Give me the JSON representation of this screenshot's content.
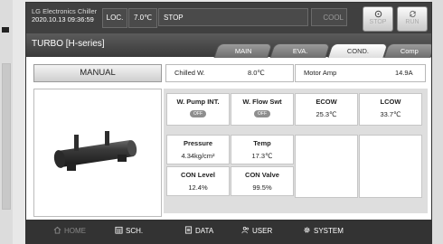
{
  "status": {
    "brand": "LG Electronics Chiller",
    "datetime": "2020.10.13 09:36:59",
    "mode": "LOC.",
    "temperature": "7.0℃",
    "state": "STOP",
    "operation": "COOL",
    "stop_label": "STOP",
    "run_label": "RUN"
  },
  "header": {
    "model": "TURBO [H-series]",
    "tabs": [
      "MAIN",
      "EVA.",
      "COND.",
      "Comp"
    ],
    "active_tab": "COND."
  },
  "main": {
    "manual_label": "MANUAL",
    "chilled_w": {
      "label": "Chilled W.",
      "value": "8.0℃"
    },
    "motor_amp": {
      "label": "Motor Amp",
      "value": "14.9A"
    },
    "cells": [
      {
        "label": "W. Pump INT.",
        "value": "OFF"
      },
      {
        "label": "W. Flow Swt",
        "value": "OFF"
      },
      {
        "label": "ECOW",
        "value": "25.3℃"
      },
      {
        "label": "LCOW",
        "value": "33.7℃"
      },
      {
        "label": "Pressure",
        "value": "4.34kg/cm²"
      },
      {
        "label": "Temp",
        "value": "17.3℃"
      },
      {
        "label": "",
        "value": ""
      },
      {
        "label": "",
        "value": ""
      },
      {
        "label": "CON Level",
        "value": "12.4%"
      },
      {
        "label": "CON Valve",
        "value": "99.5%"
      },
      {
        "label": "",
        "value": ""
      },
      {
        "label": "",
        "value": ""
      }
    ]
  },
  "nav": {
    "items": [
      "HOME",
      "SCH.",
      "DATA",
      "USER",
      "SYSTEM"
    ]
  },
  "colors": {
    "status_bg": "#404040",
    "tab_active": "#ffffff",
    "nav_bg": "#333333",
    "toggle_off": "#8e8e8e"
  },
  "icons": [
    "power-icon",
    "refresh-icon",
    "home-icon",
    "calendar-icon",
    "data-icon",
    "user-icon",
    "gear-icon"
  ]
}
